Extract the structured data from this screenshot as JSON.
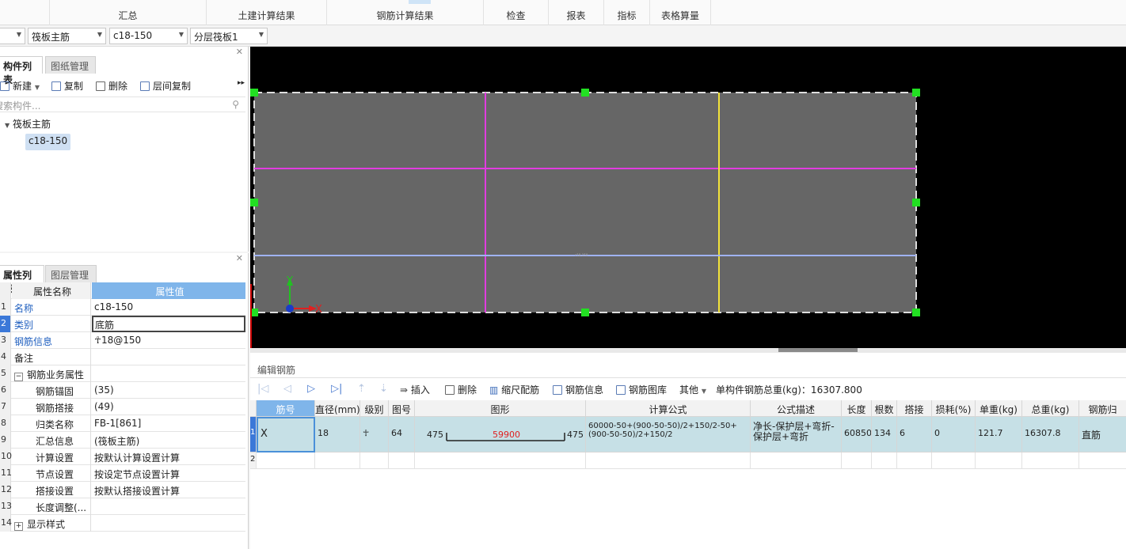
{
  "ribbon": {
    "tabs": [
      "汇总",
      "土建计算结果",
      "钢筋计算结果",
      "检查",
      "报表",
      "指标",
      "表格算量"
    ]
  },
  "selectors": {
    "type": "筏板主筋",
    "name": "c18-150",
    "layer": "分层筏板1"
  },
  "component_panel": {
    "tabs": [
      "构件列表",
      "图纸管理"
    ],
    "toolbar": {
      "new": "新建",
      "copy": "复制",
      "delete": "删除",
      "layer_copy": "层间复制"
    },
    "search_placeholder": "搜索构件...",
    "tree": {
      "root": "筏板主筋",
      "leaf": "c18-150"
    }
  },
  "property_panel": {
    "tabs": [
      "属性列表",
      "图层管理"
    ],
    "header": {
      "name": "属性名称",
      "value": "属性值"
    },
    "rows": [
      {
        "n": "1",
        "name": "名称",
        "value": "c18-150"
      },
      {
        "n": "2",
        "name": "类别",
        "value": "底筋"
      },
      {
        "n": "3",
        "name": "钢筋信息",
        "value": "☥18@150"
      },
      {
        "n": "4",
        "name": "备注",
        "value": ""
      },
      {
        "n": "5",
        "name": "钢筋业务属性",
        "value": ""
      },
      {
        "n": "6",
        "name": "钢筋锚固",
        "value": "(35)"
      },
      {
        "n": "7",
        "name": "钢筋搭接",
        "value": "(49)"
      },
      {
        "n": "8",
        "name": "归类名称",
        "value": "FB-1[861]"
      },
      {
        "n": "9",
        "name": "汇总信息",
        "value": "(筏板主筋)"
      },
      {
        "n": "10",
        "name": "计算设置",
        "value": "按默认计算设置计算"
      },
      {
        "n": "11",
        "name": "节点设置",
        "value": "按设定节点设置计算"
      },
      {
        "n": "12",
        "name": "搭接设置",
        "value": "按默认搭接设置计算"
      },
      {
        "n": "13",
        "name": "长度调整(...",
        "value": ""
      },
      {
        "n": "14",
        "name": "显示样式",
        "value": ""
      }
    ]
  },
  "canvas": {
    "axis_y": "Y",
    "axis_x": "X",
    "colors": {
      "background": "#000000",
      "slab": "#666666",
      "magenta": "#e23ce0",
      "yellow": "#f2e33a",
      "lightblue": "#9fb3f5",
      "grip": "#22e022"
    }
  },
  "edit_rebar": {
    "title": "编辑钢筋",
    "toolbar": {
      "insert": "插入",
      "delete": "删除",
      "scale": "缩尺配筋",
      "info": "钢筋信息",
      "library": "钢筋图库",
      "other": "其他",
      "total": "单构件钢筋总重(kg)：16307.800"
    },
    "columns": [
      "筋号",
      "直径(mm)",
      "级别",
      "图号",
      "图形",
      "计算公式",
      "公式描述",
      "长度",
      "根数",
      "搭接",
      "损耗(%)",
      "单重(kg)",
      "总重(kg)",
      "钢筋归"
    ],
    "row": {
      "index": "1",
      "bar_no": "X",
      "diameter": "18",
      "grade": "☥",
      "fig_no": "64",
      "shape_left": "475",
      "shape_mid": "59900",
      "shape_right": "475",
      "formula_1": "60000-50+(900-50-50)/2+150/2-50+",
      "formula_2": "(900-50-50)/2+150/2",
      "desc_1": "净长-保护层+弯折-",
      "desc_2": "保护层+弯折",
      "length": "60850",
      "count": "134",
      "lap": "6",
      "loss": "0",
      "unit_weight": "121.7",
      "total_weight": "16307.8",
      "type": "直筋"
    },
    "row2_index": "2"
  }
}
